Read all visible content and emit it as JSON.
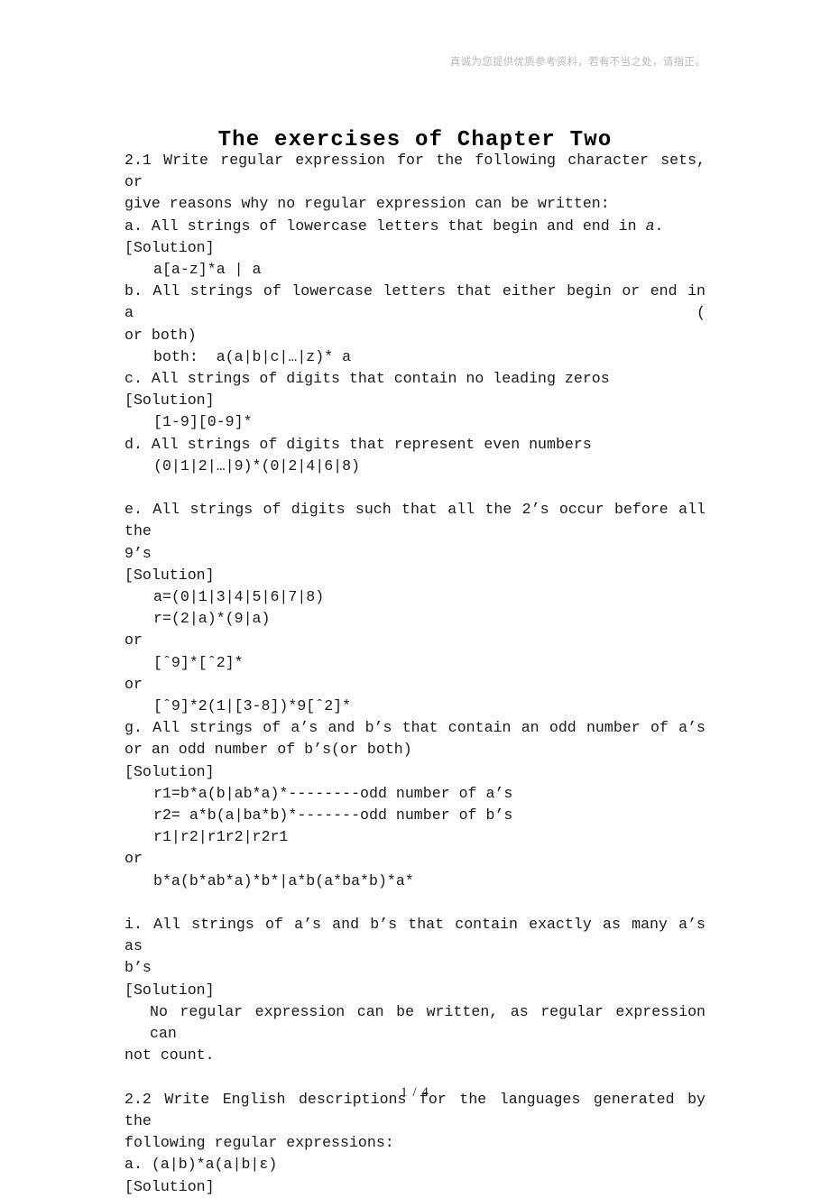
{
  "header": {
    "watermark": "真诚为您提供优质参考资料，若有不当之处，请指正。"
  },
  "title": "The exercises of Chapter Two",
  "footer": {
    "page_indicator": "1 / 4"
  },
  "colors": {
    "text": "#1a1a1a",
    "watermark": "#b9b9b9",
    "background": "#ffffff"
  },
  "content": {
    "l01": "2.1 Write regular expression for the following character sets, or",
    "l02": "give reasons why no regular expression can be written:",
    "l03a": "a. All strings of lowercase letters that begin and end in ",
    "l03b": "a",
    "l03c": ".",
    "l04": "[Solution]",
    "l05": "a[a-z]*a | a",
    "l06": "b. All strings of lowercase letters that either begin or end in a (",
    "l07": "or both)",
    "l08": "both:  a(a|b|c|…|z)* a",
    "l09": "c. All strings of digits that contain no leading zeros",
    "l10": "[Solution]",
    "l11": "[1-9][0-9]*",
    "l12": "d. All strings of digits that represent even numbers",
    "l13": "(0|1|2|…|9)*(0|2|4|6|8)",
    "l14": "e. All strings of digits such that all the 2’s occur before all the",
    "l15": "9’s",
    "l16": "[Solution]",
    "l17": "a=(0|1|3|4|5|6|7|8)",
    "l18": "r=(2|a)*(9|a)",
    "l19": "or",
    "l20": "[ˆ9]*[ˆ2]*",
    "l21": "or",
    "l22": "[ˆ9]*2(1|[3-8])*9[ˆ2]*",
    "l23": "g. All strings of a’s and b’s that contain an odd number of a’s",
    "l24": "or an odd number of b’s(or both)",
    "l25": "[Solution]",
    "l26": "r1=b*a(b|ab*a)*--------odd number of a’s",
    "l27": "r2= a*b(a|ba*b)*-------odd number of b’s",
    "l28": "r1|r2|r1r2|r2r1",
    "l29": "or",
    "l30": "b*a(b*ab*a)*b*|a*b(a*ba*b)*a*",
    "l31": "i. All strings of a’s and b’s that contain exactly as many a’s as",
    "l32": "b’s",
    "l33": "[Solution]",
    "l34": "No regular expression can be written, as regular expression can",
    "l35": "not count.",
    "l36": "2.2 Write English descriptions for the languages generated by the",
    "l37": "following regular expressions:",
    "l38": "a. (a|b)*a(a|b|ε)",
    "l39": "[Solution]"
  }
}
